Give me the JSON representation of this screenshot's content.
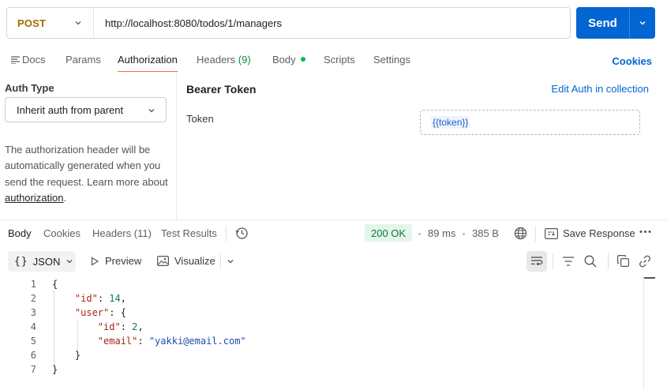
{
  "request": {
    "method": "POST",
    "url": "http://localhost:8080/todos/1/managers",
    "send_label": "Send"
  },
  "request_tabs": [
    {
      "label": "Docs"
    },
    {
      "label": "Params"
    },
    {
      "label": "Authorization",
      "active": true
    },
    {
      "label": "Headers",
      "count": "(9)"
    },
    {
      "label": "Body"
    },
    {
      "label": "Scripts"
    },
    {
      "label": "Settings"
    }
  ],
  "cookies_label": "Cookies",
  "auth": {
    "type_label": "Auth Type",
    "type_value": "Inherit auth from parent",
    "description": "The authorization header will be automatically generated when you send the request. Learn more about ",
    "link_text": "authorization",
    "link_suffix": ".",
    "bearer_title": "Bearer Token",
    "edit_link": "Edit Auth in collection",
    "token_label": "Token",
    "token_value": "{{token}}"
  },
  "response_tabs": [
    {
      "label": "Body",
      "active": true
    },
    {
      "label": "Cookies"
    },
    {
      "label": "Headers (11)"
    },
    {
      "label": "Test Results"
    }
  ],
  "response_meta": {
    "status": "200 OK",
    "time": "89 ms",
    "size": "385 B",
    "save_label": "Save Response"
  },
  "viewer": {
    "format": "JSON",
    "preview_label": "Preview",
    "visualize_label": "Visualize"
  },
  "code_lines": [
    {
      "n": "1"
    },
    {
      "n": "2",
      "key": "\"id\"",
      "num": "14"
    },
    {
      "n": "3",
      "key": "\"user\""
    },
    {
      "n": "4",
      "key": "\"id\"",
      "num": "2"
    },
    {
      "n": "5",
      "key": "\"email\"",
      "str": "\"yakki@email.com\""
    },
    {
      "n": "6"
    },
    {
      "n": "7"
    }
  ],
  "colors": {
    "accent": "#0265d2",
    "method_post": "#a16d00",
    "tab_underline": "#ff6c37",
    "status_ok": "#0a7a33"
  }
}
